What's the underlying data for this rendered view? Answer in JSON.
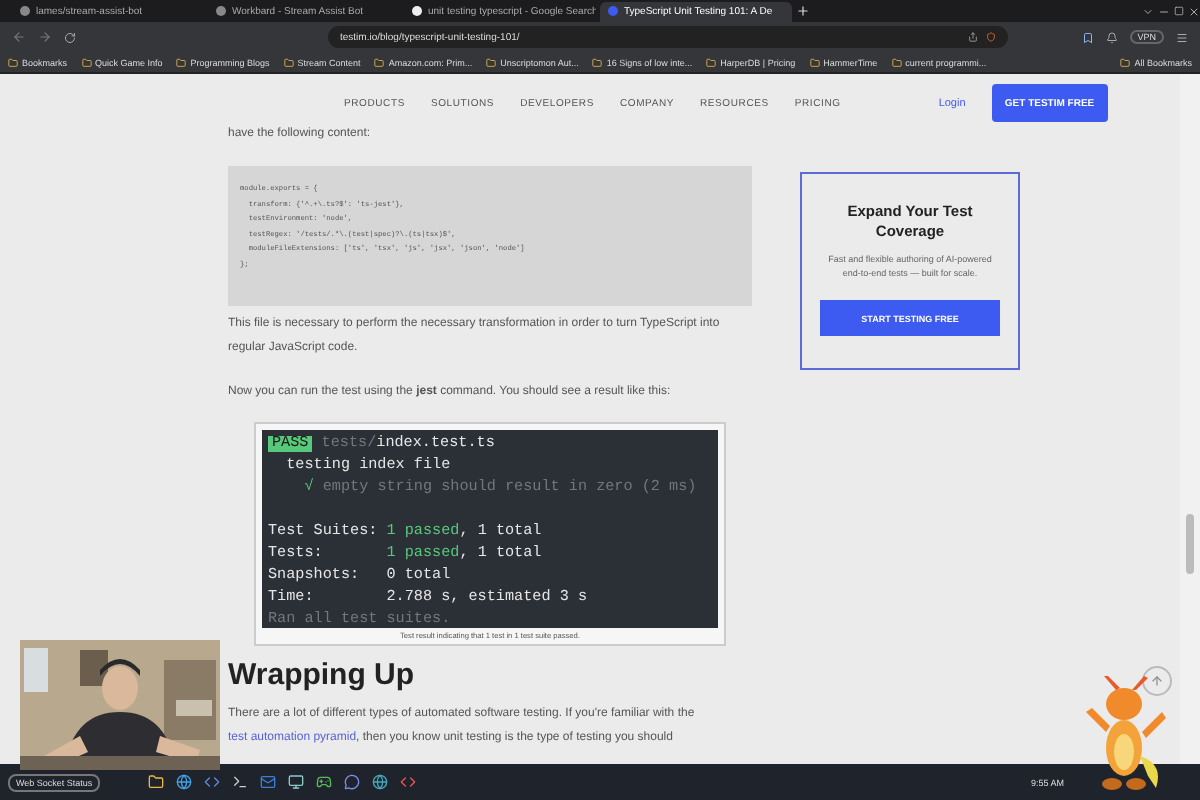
{
  "browser": {
    "tabs": [
      {
        "title": "lames/stream-assist-bot",
        "selected": false
      },
      {
        "title": "Workbard - Stream Assist Bot",
        "selected": false
      },
      {
        "title": "unit testing typescript - Google Search",
        "selected": false
      },
      {
        "title": "TypeScript Unit Testing 101: A De",
        "selected": true
      }
    ],
    "address": "testim.io/blog/typescript-unit-testing-101/",
    "vpn": "VPN",
    "bookmarks": [
      "Bookmarks",
      "Quick Game Info",
      "Programming Blogs",
      "Stream Content",
      "Amazon.com: Prim...",
      "Unscriptomon Aut...",
      "16 Signs of low inte...",
      "HarperDB | Pricing",
      "HammerTime",
      "current programmi..."
    ],
    "all_bookmarks": "All Bookmarks"
  },
  "site_nav": {
    "items": [
      "PRODUCTS",
      "SOLUTIONS",
      "DEVELOPERS",
      "COMPANY",
      "RESOURCES",
      "PRICING"
    ],
    "login": "Login",
    "cta": "GET TESTIM FREE"
  },
  "article": {
    "intro_fragment": "have the following content:",
    "code_lines": [
      "module.exports = {",
      "  transform: {'^.+\\.ts?$': 'ts-jest'},",
      "  testEnvironment: 'node',",
      "  testRegex: '/tests/.*\\.(test|spec)?\\.(ts|tsx)$',",
      "  moduleFileExtensions: ['ts', 'tsx', 'js', 'jsx', 'json', 'node']",
      "};"
    ],
    "paragraph_1": "This file is necessary to perform the necessary transformation in order to turn TypeScript into regular JavaScript code.",
    "paragraph_2": "Now you can run the test using the **jest** command. You should see a result like this:",
    "terminal": [
      {
        "kind": "line",
        "segments": [
          {
            "text": "PASS",
            "kind": "badge"
          },
          {
            "text": " tests/",
            "kind": "dim"
          },
          {
            "text": "index.test.ts",
            "kind": "plain"
          }
        ]
      },
      {
        "kind": "line",
        "segments": [
          {
            "text": "  testing index file",
            "kind": "plain"
          }
        ]
      },
      {
        "kind": "line",
        "segments": [
          {
            "text": "    √",
            "kind": "green"
          },
          {
            "text": " empty string should result in zero (2 ms)",
            "kind": "dim"
          }
        ]
      },
      {
        "kind": "spacer"
      },
      {
        "kind": "line",
        "segments": [
          {
            "text": "Test Suites: ",
            "kind": "plain"
          },
          {
            "text": "1 passed",
            "kind": "green"
          },
          {
            "text": ", 1 total",
            "kind": "plain"
          }
        ]
      },
      {
        "kind": "line",
        "segments": [
          {
            "text": "Tests:       ",
            "kind": "plain"
          },
          {
            "text": "1 passed",
            "kind": "green"
          },
          {
            "text": ", 1 total",
            "kind": "plain"
          }
        ]
      },
      {
        "kind": "line",
        "segments": [
          {
            "text": "Snapshots:   0 total",
            "kind": "plain"
          }
        ]
      },
      {
        "kind": "line",
        "segments": [
          {
            "text": "Time:        2.788 s, estimated 3 s",
            "kind": "plain"
          }
        ]
      },
      {
        "kind": "line",
        "segments": [
          {
            "text": "Ran all test suites.",
            "kind": "dim"
          }
        ]
      }
    ],
    "caption": "Test result indicating that 1 test in 1 test suite passed.",
    "heading": "Wrapping Up",
    "paragraph_3": {
      "before": "There are a lot of different types of automated software testing. If you're familiar with the",
      "link": "test automation pyramid",
      "after": ", then you know unit testing is the type of testing you should"
    }
  },
  "sidebar_card": {
    "title": "Expand Your Test Coverage",
    "text": "Fast and flexible authoring of AI-powered end-to-end tests — built for scale.",
    "button": "START TESTING FREE"
  },
  "taskbar": {
    "pinned_label": "Web Socket Status",
    "time": "9:55 AM"
  }
}
